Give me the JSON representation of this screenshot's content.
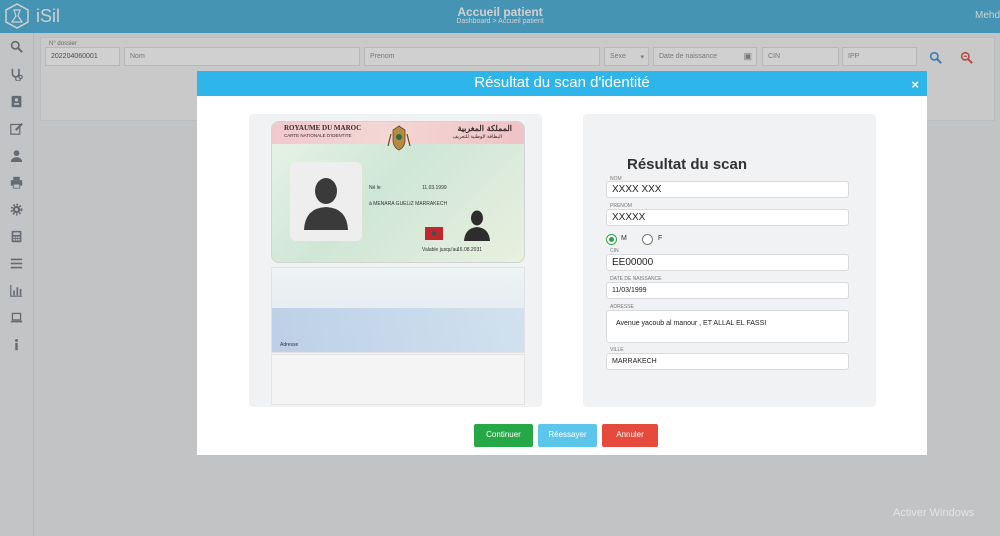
{
  "app": {
    "name": "iSil",
    "user_menu": "Mehdi"
  },
  "header": {
    "title": "Accueil patient",
    "breadcrumb": "Dashboard > Accueil patient"
  },
  "sidebar": {
    "icons": [
      "search-icon",
      "stethoscope-icon",
      "id-card-icon",
      "edit-icon",
      "user-icon",
      "printer-icon",
      "gear-icon",
      "calculator-icon",
      "list-icon",
      "bar-chart-icon",
      "laptop-icon",
      "info-icon"
    ]
  },
  "filter": {
    "dossier_label": "N° dossier",
    "dossier_value": "202204060001",
    "nom_placeholder": "Nom",
    "prenom_placeholder": "Prenom",
    "sexe_placeholder": "Sexe",
    "dob_placeholder": "Date de naissance",
    "cin_placeholder": "CIN",
    "ipp_placeholder": "IPP"
  },
  "modal": {
    "title": "Résultat du scan d'identité",
    "close": "×",
    "card": {
      "title_fr": "ROYAUME DU MAROC",
      "subtitle_fr": "CARTE NATIONALE D'IDENTITE",
      "title_ar": "المملكة المغربية",
      "subtitle_ar": "البطاقة الوطنية للتعريف",
      "birth_label": "Né le",
      "birth_date": "11.03.1999",
      "birth_place": "à MENARA GUELIZ MARRAKECH",
      "validity_label": "Valable jusqu'au",
      "validity_date": "16.08.2031",
      "back_text": "Adresse"
    },
    "result": {
      "title": "Résultat du scan",
      "nom_label": "NOM",
      "nom_value": "XXXX XXX",
      "prenom_label": "PRENOM",
      "prenom_value": "XXXXX",
      "sexe_m": "M",
      "sexe_f": "F",
      "cin_label": "CIN",
      "cin_value": "EE00000",
      "dob_label": "DATE DE NAISSANCE",
      "dob_value": "11/03/1999",
      "adresse_label": "Adresse",
      "adresse_value": "Avenue yacoub al manour , ET ALLAL EL FASSI",
      "ville_label": "Ville",
      "ville_value": "MARRAKECH"
    },
    "buttons": {
      "continue": "Continuer",
      "retry": "Réessayer",
      "cancel": "Annuler"
    }
  },
  "colors": {
    "header": "#2aa4d5",
    "modal_header": "#2eb6ea",
    "continue": "#26a846",
    "retry": "#5bc6ea",
    "cancel": "#e64a3c"
  },
  "os_watermark": "Activer Windows"
}
